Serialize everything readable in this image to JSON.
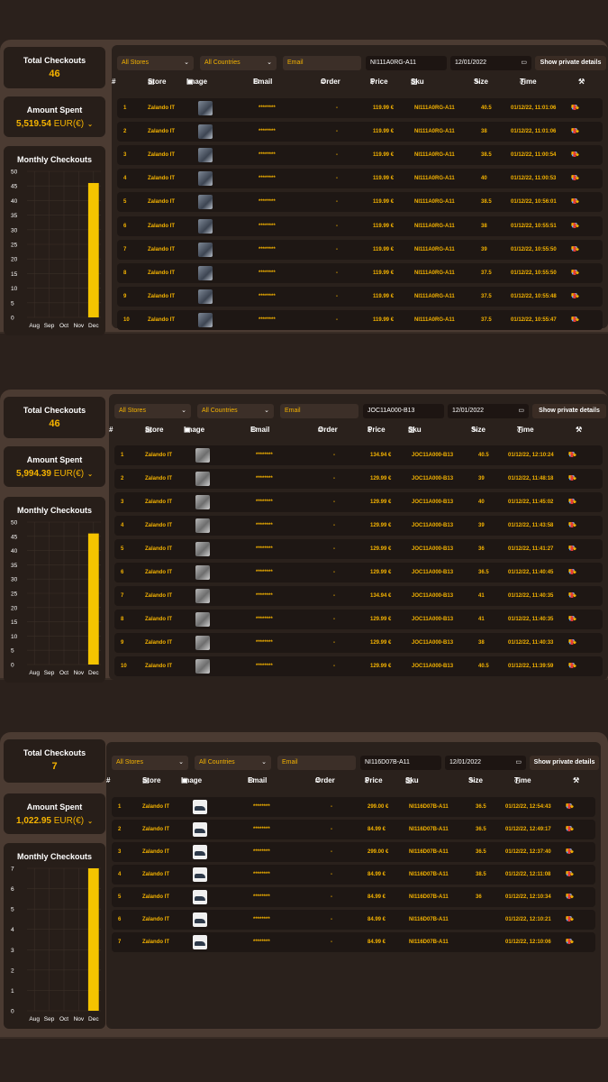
{
  "headers": {
    "num": "#",
    "store": "Store",
    "image": "Image",
    "email": "Email",
    "order": "Order",
    "price": "Price",
    "sku": "Sku",
    "size": "Size",
    "time": "Time"
  },
  "icons": {
    "store": "store-icon",
    "image": "image-icon",
    "email": "envelope-icon",
    "order": "hash-icon",
    "price": "dollar-icon",
    "sku": "tag-icon",
    "size": "pencil-icon",
    "time": "clock-icon",
    "settings": "wrench-icon",
    "row_actions": [
      "cart-icon",
      "expand-icon",
      "trash-icon"
    ]
  },
  "colors": {
    "accent": "#f5b300",
    "bar": "#f5c400",
    "delete": "#e53935",
    "expand": "#5aa7ff"
  },
  "panels": [
    {
      "total_checkouts_label": "Total Checkouts",
      "total_checkouts": "46",
      "amount_spent_label": "Amount Spent",
      "amount_spent": "5,519.54",
      "currency": "EUR(€)",
      "filters": {
        "stores": "All Stores",
        "countries": "All Countries",
        "email_placeholder": "Email",
        "sku": "NI111A0RG-A11",
        "date": "12/01/2022",
        "private_btn": "Show private details"
      },
      "chart_data": {
        "type": "bar",
        "title": "Monthly Checkouts",
        "categories": [
          "Aug",
          "Sep",
          "Oct",
          "Nov",
          "Dec"
        ],
        "values": [
          0,
          0,
          0,
          0,
          46
        ],
        "ylim": [
          0,
          50
        ],
        "yticks": [
          "0",
          "5",
          "10",
          "15",
          "20",
          "25",
          "30",
          "35",
          "40",
          "45",
          "50"
        ]
      },
      "rows": [
        {
          "n": "1",
          "store": "Zalando IT",
          "email": "********",
          "order": "-",
          "price": "119.99 €",
          "sku": "NI111A0RG-A11",
          "size": "40.5",
          "time": "01/12/22, 11:01:06"
        },
        {
          "n": "2",
          "store": "Zalando IT",
          "email": "********",
          "order": "-",
          "price": "119.99 €",
          "sku": "NI111A0RG-A11",
          "size": "38",
          "time": "01/12/22, 11:01:06"
        },
        {
          "n": "3",
          "store": "Zalando IT",
          "email": "********",
          "order": "-",
          "price": "119.99 €",
          "sku": "NI111A0RG-A11",
          "size": "38.5",
          "time": "01/12/22, 11:00:54"
        },
        {
          "n": "4",
          "store": "Zalando IT",
          "email": "********",
          "order": "-",
          "price": "119.99 €",
          "sku": "NI111A0RG-A11",
          "size": "40",
          "time": "01/12/22, 11:00:53"
        },
        {
          "n": "5",
          "store": "Zalando IT",
          "email": "********",
          "order": "-",
          "price": "119.99 €",
          "sku": "NI111A0RG-A11",
          "size": "38.5",
          "time": "01/12/22, 10:56:01"
        },
        {
          "n": "6",
          "store": "Zalando IT",
          "email": "********",
          "order": "-",
          "price": "119.99 €",
          "sku": "NI111A0RG-A11",
          "size": "38",
          "time": "01/12/22, 10:55:51"
        },
        {
          "n": "7",
          "store": "Zalando IT",
          "email": "********",
          "order": "-",
          "price": "119.99 €",
          "sku": "NI111A0RG-A11",
          "size": "39",
          "time": "01/12/22, 10:55:50"
        },
        {
          "n": "8",
          "store": "Zalando IT",
          "email": "********",
          "order": "-",
          "price": "119.99 €",
          "sku": "NI111A0RG-A11",
          "size": "37.5",
          "time": "01/12/22, 10:55:50"
        },
        {
          "n": "9",
          "store": "Zalando IT",
          "email": "********",
          "order": "-",
          "price": "119.99 €",
          "sku": "NI111A0RG-A11",
          "size": "37.5",
          "time": "01/12/22, 10:55:48"
        },
        {
          "n": "10",
          "store": "Zalando IT",
          "email": "********",
          "order": "-",
          "price": "119.99 €",
          "sku": "NI111A0RG-A11",
          "size": "37.5",
          "time": "01/12/22, 10:55:47"
        }
      ]
    },
    {
      "total_checkouts_label": "Total Checkouts",
      "total_checkouts": "46",
      "amount_spent_label": "Amount Spent",
      "amount_spent": "5,994.39",
      "currency": "EUR(€)",
      "filters": {
        "stores": "All Stores",
        "countries": "All Countries",
        "email_placeholder": "Email",
        "sku": "JOC11A000-B13",
        "date": "12/01/2022",
        "private_btn": "Show private details"
      },
      "chart_data": {
        "type": "bar",
        "title": "Monthly Checkouts",
        "categories": [
          "Aug",
          "Sep",
          "Oct",
          "Nov",
          "Dec"
        ],
        "values": [
          0,
          0,
          0,
          0,
          46
        ],
        "ylim": [
          0,
          50
        ],
        "yticks": [
          "0",
          "5",
          "10",
          "15",
          "20",
          "25",
          "30",
          "35",
          "40",
          "45",
          "50"
        ]
      },
      "rows": [
        {
          "n": "1",
          "store": "Zalando IT",
          "email": "********",
          "order": "-",
          "price": "134.94 €",
          "sku": "JOC11A000-B13",
          "size": "40.5",
          "time": "01/12/22, 12:10:24"
        },
        {
          "n": "2",
          "store": "Zalando IT",
          "email": "********",
          "order": "-",
          "price": "129.99 €",
          "sku": "JOC11A000-B13",
          "size": "39",
          "time": "01/12/22, 11:48:18"
        },
        {
          "n": "3",
          "store": "Zalando IT",
          "email": "********",
          "order": "-",
          "price": "129.99 €",
          "sku": "JOC11A000-B13",
          "size": "40",
          "time": "01/12/22, 11:45:02"
        },
        {
          "n": "4",
          "store": "Zalando IT",
          "email": "********",
          "order": "-",
          "price": "129.99 €",
          "sku": "JOC11A000-B13",
          "size": "39",
          "time": "01/12/22, 11:43:58"
        },
        {
          "n": "5",
          "store": "Zalando IT",
          "email": "********",
          "order": "-",
          "price": "129.99 €",
          "sku": "JOC11A000-B13",
          "size": "36",
          "time": "01/12/22, 11:41:27"
        },
        {
          "n": "6",
          "store": "Zalando IT",
          "email": "********",
          "order": "-",
          "price": "129.99 €",
          "sku": "JOC11A000-B13",
          "size": "36.5",
          "time": "01/12/22, 11:40:45"
        },
        {
          "n": "7",
          "store": "Zalando IT",
          "email": "********",
          "order": "-",
          "price": "134.94 €",
          "sku": "JOC11A000-B13",
          "size": "41",
          "time": "01/12/22, 11:40:35"
        },
        {
          "n": "8",
          "store": "Zalando IT",
          "email": "********",
          "order": "-",
          "price": "129.99 €",
          "sku": "JOC11A000-B13",
          "size": "41",
          "time": "01/12/22, 11:40:35"
        },
        {
          "n": "9",
          "store": "Zalando IT",
          "email": "********",
          "order": "-",
          "price": "129.99 €",
          "sku": "JOC11A000-B13",
          "size": "38",
          "time": "01/12/22, 11:40:33"
        },
        {
          "n": "10",
          "store": "Zalando IT",
          "email": "********",
          "order": "-",
          "price": "129.99 €",
          "sku": "JOC11A000-B13",
          "size": "40.5",
          "time": "01/12/22, 11:39:59"
        }
      ]
    },
    {
      "total_checkouts_label": "Total Checkouts",
      "total_checkouts": "7",
      "amount_spent_label": "Amount Spent",
      "amount_spent": "1,022.95",
      "currency": "EUR(€)",
      "filters": {
        "stores": "All Stores",
        "countries": "All Countries",
        "email_placeholder": "Email",
        "sku": "NI116D07B-A11",
        "date": "12/01/2022",
        "private_btn": "Show private details"
      },
      "chart_data": {
        "type": "bar",
        "title": "Monthly Checkouts",
        "categories": [
          "Aug",
          "Sep",
          "Oct",
          "Nov",
          "Dec"
        ],
        "values": [
          0,
          0,
          0,
          0,
          7
        ],
        "ylim": [
          0,
          7
        ],
        "yticks": [
          "0",
          "1",
          "2",
          "3",
          "4",
          "5",
          "6",
          "7"
        ]
      },
      "rows": [
        {
          "n": "1",
          "store": "Zalando IT",
          "email": "********",
          "order": "-",
          "price": "299.00 €",
          "sku": "NI116D07B-A11",
          "size": "36.5",
          "time": "01/12/22, 12:54:43"
        },
        {
          "n": "2",
          "store": "Zalando IT",
          "email": "********",
          "order": "-",
          "price": "84.99 €",
          "sku": "NI116D07B-A11",
          "size": "36.5",
          "time": "01/12/22, 12:49:17"
        },
        {
          "n": "3",
          "store": "Zalando IT",
          "email": "********",
          "order": "-",
          "price": "299.00 €",
          "sku": "NI116D07B-A11",
          "size": "36.5",
          "time": "01/12/22, 12:37:40"
        },
        {
          "n": "4",
          "store": "Zalando IT",
          "email": "********",
          "order": "-",
          "price": "84.99 €",
          "sku": "NI116D07B-A11",
          "size": "38.5",
          "time": "01/12/22, 12:11:08"
        },
        {
          "n": "5",
          "store": "Zalando IT",
          "email": "********",
          "order": "-",
          "price": "84.99 €",
          "sku": "NI116D07B-A11",
          "size": "36",
          "time": "01/12/22, 12:10:34"
        },
        {
          "n": "6",
          "store": "Zalando IT",
          "email": "********",
          "order": "-",
          "price": "84.99 €",
          "sku": "NI116D07B-A11",
          "size": "",
          "time": "01/12/22, 12:10:21"
        },
        {
          "n": "7",
          "store": "Zalando IT",
          "email": "********",
          "order": "-",
          "price": "84.99 €",
          "sku": "NI116D07B-A11",
          "size": "",
          "time": "01/12/22, 12:10:06"
        }
      ]
    }
  ]
}
